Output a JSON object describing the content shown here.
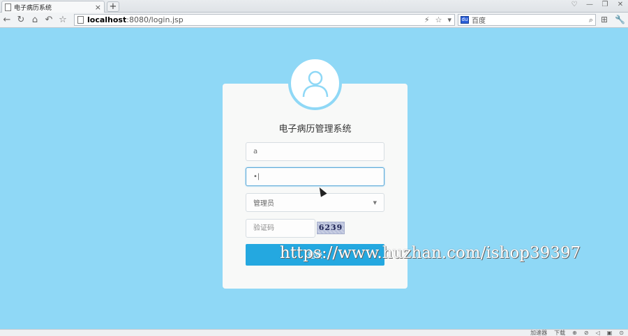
{
  "browser": {
    "tab_title": "电子病历系统",
    "tab_close": "×",
    "new_tab": "+",
    "window_controls": [
      "♡",
      "—",
      "❐",
      "✕"
    ],
    "url_host": "localhost",
    "url_rest": ":8080/login.jsp",
    "url_actions": [
      "⚡",
      "☆",
      "▾"
    ],
    "search_engine": "百度",
    "search_icon": "⌕",
    "nav_buttons": [
      "←",
      "↻",
      "⌂",
      "↶",
      "☆"
    ],
    "nav_right": [
      "⊞",
      "🔧"
    ]
  },
  "login": {
    "title": "电子病历管理系统",
    "username_value": "a",
    "password_value": "•|",
    "role_selected": "管理员",
    "captcha_placeholder": "验证码",
    "captcha_code": "6239",
    "button_label": "登录"
  },
  "watermark": "https://www.huzhan.com/ishop39397",
  "statusbar": {
    "items": [
      "加速器",
      "下载",
      "⊕",
      "⊘",
      "◁",
      "▣",
      "⊙"
    ]
  },
  "colors": {
    "background": "#8fd8f6",
    "button": "#24a8e0",
    "avatar_stroke": "#8fd8f6"
  }
}
